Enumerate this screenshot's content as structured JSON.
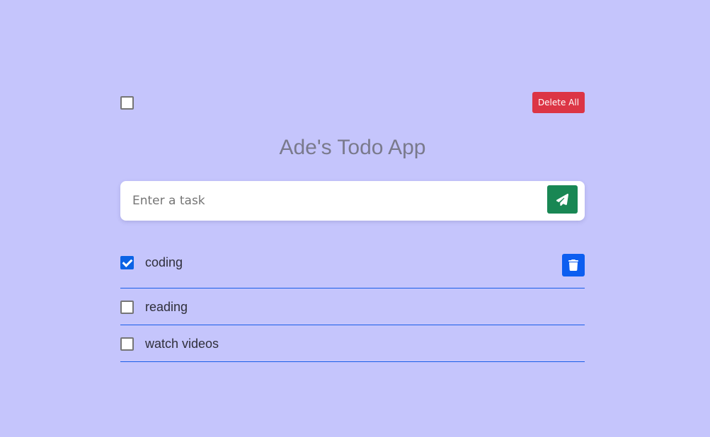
{
  "app": {
    "title": "Ade's Todo App"
  },
  "toolbar": {
    "select_all_checked": false,
    "delete_all_label": "Delete All",
    "delete_all_color": "#dc3545"
  },
  "input": {
    "placeholder": "Enter a task",
    "value": "",
    "send_icon": "paper-plane-icon",
    "send_color": "#198754"
  },
  "tasks": [
    {
      "text": "coding",
      "checked": true,
      "show_delete": true,
      "delete_icon": "trash-icon"
    },
    {
      "text": "reading",
      "checked": false,
      "show_delete": false
    },
    {
      "text": "watch videos",
      "checked": false,
      "show_delete": false
    }
  ],
  "colors": {
    "background": "#c5c5fc",
    "accent": "#0d5ef0",
    "divider": "#1a5ee8"
  }
}
